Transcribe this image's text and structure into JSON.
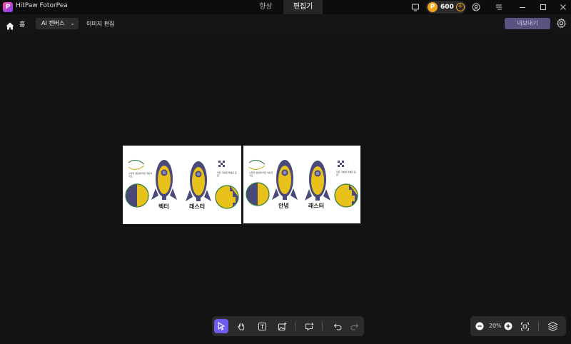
{
  "app": {
    "name": "HitPaw FotorPea"
  },
  "top_tabs": [
    {
      "label": "향상",
      "active": false
    },
    {
      "label": "편집기",
      "active": true
    }
  ],
  "credits": {
    "amount": "600"
  },
  "toolbar": {
    "home_label": "홈",
    "ai_canvas_label": "AI 캔버스",
    "edit_image_label": "이미지 편집",
    "export_label": "내보내기"
  },
  "artboards": [
    {
      "left_caption": "수학적 경로에 따른 색상과 각도",
      "right_caption": "작은 기본점 픽셀로 표현",
      "word_left": "벡터",
      "word_right": "래스터"
    },
    {
      "left_caption": "수학적 경로에 따른 색상과 각도",
      "right_caption": "작은 기본점 픽셀로 표현",
      "word_left": "안녕",
      "word_right": "래스터"
    }
  ],
  "zoom": {
    "value": "20%"
  },
  "colors": {
    "accent": "#6f5cf0",
    "coin": "#f2a516",
    "export_bg": "#5a5280",
    "rocket_body": "#e8c21b",
    "rocket_dark": "#4a4a7a"
  }
}
